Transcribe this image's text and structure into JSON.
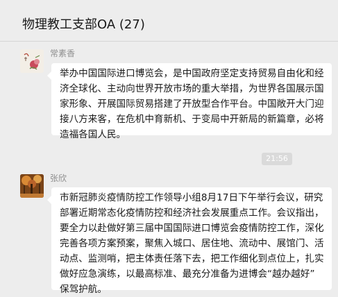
{
  "header": {
    "title": "物理教工支部OA (27)"
  },
  "messages": [
    {
      "sender": "常素香",
      "lines": [
        "举办中国国际进口博览会，是中国政府坚定支持贸易自由化和经",
        "济全球化、主动向世界开放市场的重大举措，为世界各国展示国",
        "家形象、开展国际贸易搭建了开放型合作平台。中国敞开大门迎",
        "接八方来客，在危机中育新机、于变局中开新局的新篇章，必将",
        "造福各国人民。"
      ]
    },
    {
      "sender": "张欣",
      "lines": [
        "市新冠肺炎疫情防控工作领导小组8月17日下午举行会议，研究",
        "部署近期常态化疫情防控和经济社会发展重点工作。会议指出，",
        "要全力以赴做好第三届中国国际进口博览会疫情防控工作，深化",
        "完善各项方案预案，聚焦入城口、居住地、流动中、展馆门、活",
        "动点、监测哨，把主体责任落下去，把工作细化到点位上，扎实",
        "做好应急演练，以最高标准、最充分准备为进博会“越办越好”",
        "保驾护航。"
      ]
    }
  ],
  "timestamp": "21:56"
}
